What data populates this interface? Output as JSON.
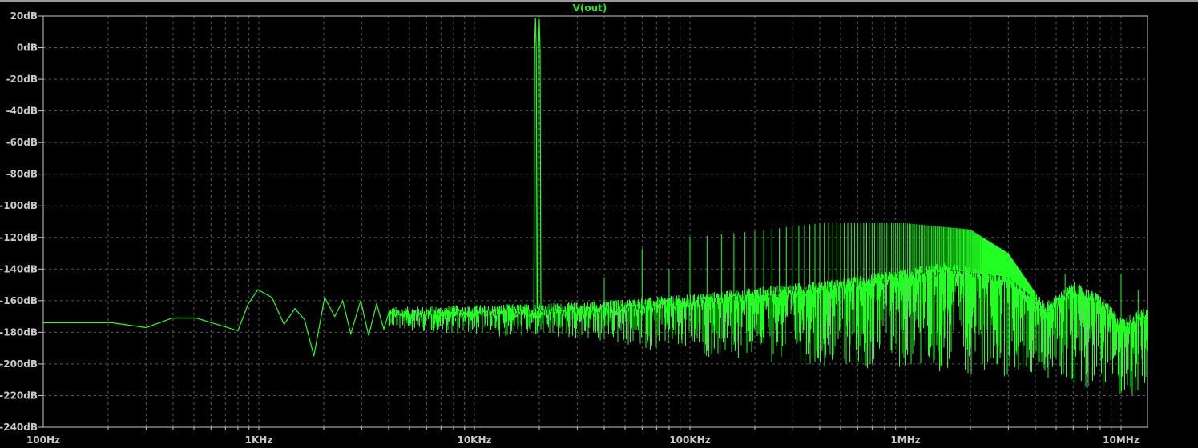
{
  "chart_data": {
    "type": "line",
    "title": "V(out)",
    "xlabel": "",
    "ylabel": "",
    "x_scale": "log",
    "xlim": [
      100,
      13000000
    ],
    "ylim": [
      -240,
      20
    ],
    "grid": true,
    "x_ticks": [
      {
        "value": 100,
        "label": "100Hz"
      },
      {
        "value": 1000,
        "label": "1KHz"
      },
      {
        "value": 10000,
        "label": "10KHz"
      },
      {
        "value": 100000,
        "label": "100KHz"
      },
      {
        "value": 1000000,
        "label": "1MHz"
      },
      {
        "value": 10000000,
        "label": "10MHz"
      }
    ],
    "y_ticks": [
      {
        "value": 20,
        "label": "20dB"
      },
      {
        "value": 0,
        "label": "0dB"
      },
      {
        "value": -20,
        "label": "-20dB"
      },
      {
        "value": -40,
        "label": "-40dB"
      },
      {
        "value": -60,
        "label": "-60dB"
      },
      {
        "value": -80,
        "label": "-80dB"
      },
      {
        "value": -100,
        "label": "-100dB"
      },
      {
        "value": -120,
        "label": "-120dB"
      },
      {
        "value": -140,
        "label": "-140dB"
      },
      {
        "value": -160,
        "label": "-160dB"
      },
      {
        "value": -180,
        "label": "-180dB"
      },
      {
        "value": -200,
        "label": "-200dB"
      },
      {
        "value": -220,
        "label": "-220dB"
      },
      {
        "value": -240,
        "label": "-240dB"
      }
    ],
    "series": [
      {
        "name": "V(out)",
        "color": "#22ff22",
        "low_frequency_trace": [
          [
            100,
            -174
          ],
          [
            209,
            -174
          ],
          [
            300,
            -177
          ],
          [
            397,
            -171
          ],
          [
            512,
            -171
          ],
          [
            800,
            -179
          ],
          [
            893,
            -162
          ],
          [
            990,
            -153
          ],
          [
            1150,
            -158
          ],
          [
            1310,
            -175
          ],
          [
            1470,
            -165
          ],
          [
            1630,
            -172
          ],
          [
            1800,
            -195
          ],
          [
            2020,
            -158
          ],
          [
            2250,
            -170
          ],
          [
            2450,
            -160
          ],
          [
            2670,
            -181
          ],
          [
            2970,
            -160
          ],
          [
            3230,
            -182
          ],
          [
            3520,
            -162
          ],
          [
            3800,
            -178
          ],
          [
            4000,
            -168
          ]
        ],
        "fundamental_peaks": [
          [
            19200,
            19
          ],
          [
            20000,
            18
          ]
        ],
        "harmonic_spacing_hz": 20000,
        "harmonic_range_hz": [
          40000,
          4000000
        ],
        "harmonic_peak_envelope": [
          [
            40000,
            -145
          ],
          [
            60000,
            -127
          ],
          [
            80000,
            -140
          ],
          [
            100000,
            -120
          ],
          [
            200000,
            -116
          ],
          [
            400000,
            -111
          ],
          [
            1000000,
            -111
          ],
          [
            2000000,
            -115
          ],
          [
            3000000,
            -130
          ],
          [
            4000000,
            -155
          ]
        ],
        "noise_top_envelope": [
          [
            4000,
            -168
          ],
          [
            30000,
            -165
          ],
          [
            100000,
            -160
          ],
          [
            500000,
            -150
          ],
          [
            1500000,
            -140
          ],
          [
            3000000,
            -145
          ],
          [
            4500000,
            -165
          ],
          [
            6000000,
            -152
          ],
          [
            8000000,
            -160
          ],
          [
            10000000,
            -175
          ],
          [
            13000000,
            -168
          ]
        ],
        "noise_bottom_envelope": [
          [
            4000,
            -178
          ],
          [
            10000,
            -182
          ],
          [
            30000,
            -185
          ],
          [
            100000,
            -195
          ],
          [
            1000000,
            -205
          ],
          [
            5000000,
            -210
          ],
          [
            13000000,
            -225
          ]
        ],
        "isolated_spikes": [
          [
            18000,
            -177
          ],
          [
            5500000,
            -143
          ],
          [
            10000000,
            -143
          ],
          [
            12000000,
            -153
          ]
        ]
      }
    ]
  }
}
